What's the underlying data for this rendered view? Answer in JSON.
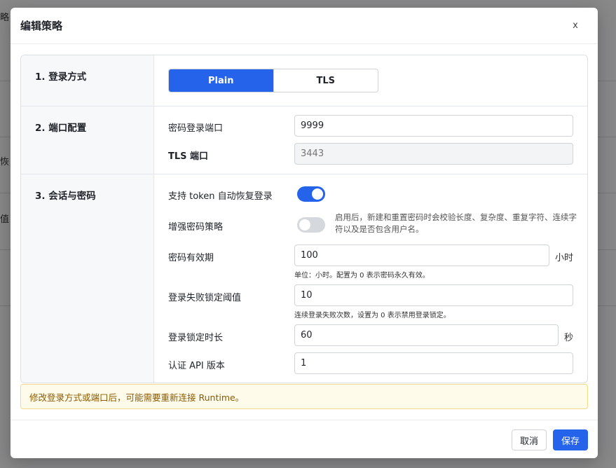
{
  "background": {
    "fragments": [
      "略",
      "恢",
      "值"
    ]
  },
  "modal": {
    "title": "编辑策略",
    "close_label": "x"
  },
  "sections": {
    "login_method": {
      "label": "1. 登录方式",
      "options": [
        "Plain",
        "TLS"
      ],
      "selected": "Plain"
    },
    "port_config": {
      "label": "2. 端口配置",
      "password_port_label": "密码登录端口",
      "password_port_value": "9999",
      "tls_port_label": "TLS 端口",
      "tls_port_placeholder": "3443"
    },
    "session_password": {
      "label": "3. 会话与密码",
      "token_restore_label": "支持 token 自动恢复登录",
      "token_restore_enabled": true,
      "enhanced_policy_label": "增强密码策略",
      "enhanced_policy_enabled": false,
      "enhanced_policy_desc": "启用后，新建和重置密码时会校验长度、复杂度、重复字符、连续字符以及是否包含用户名。",
      "password_validity_label": "密码有效期",
      "password_validity_value": "100",
      "password_validity_unit": "小时",
      "password_validity_hint": "单位：小时。配置为 0 表示密码永久有效。",
      "lock_threshold_label": "登录失败锁定阈值",
      "lock_threshold_value": "10",
      "lock_threshold_hint": "连续登录失败次数，设置为 0 表示禁用登录锁定。",
      "lock_duration_label": "登录锁定时长",
      "lock_duration_value": "60",
      "lock_duration_unit": "秒",
      "api_version_label": "认证 API 版本",
      "api_version_value": "1"
    }
  },
  "warning": "修改登录方式或端口后，可能需要重新连接 Runtime。",
  "footer": {
    "cancel_label": "取消",
    "save_label": "保存"
  },
  "colors": {
    "accent": "#2563eb",
    "warning_bg": "#fffbea",
    "warning_text": "#8a5a00"
  }
}
